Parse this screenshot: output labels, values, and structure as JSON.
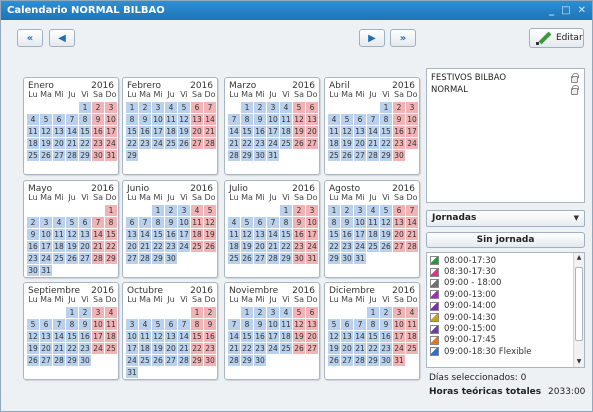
{
  "window": {
    "title": "Calendario NORMAL BILBAO",
    "minimize": "_",
    "maximize": "□",
    "close": "✕"
  },
  "toolbar": {
    "first": "«",
    "prev": "◀",
    "next": "▶",
    "last": "»",
    "edit_label": "Editar"
  },
  "dow": [
    "Lu",
    "Ma",
    "Mi",
    "Ju",
    "Vi",
    "Sa",
    "Do"
  ],
  "months": [
    {
      "name": "Enero",
      "year": "2016",
      "offset": 4,
      "days": 31
    },
    {
      "name": "Febrero",
      "year": "2016",
      "offset": 0,
      "days": 29
    },
    {
      "name": "Marzo",
      "year": "2016",
      "offset": 1,
      "days": 31
    },
    {
      "name": "Abril",
      "year": "2016",
      "offset": 4,
      "days": 30
    },
    {
      "name": "Mayo",
      "year": "2016",
      "offset": 6,
      "days": 31
    },
    {
      "name": "Junio",
      "year": "2016",
      "offset": 2,
      "days": 30
    },
    {
      "name": "Julio",
      "year": "2016",
      "offset": 4,
      "days": 31
    },
    {
      "name": "Agosto",
      "year": "2016",
      "offset": 0,
      "days": 31
    },
    {
      "name": "Septiembre",
      "year": "2016",
      "offset": 3,
      "days": 30
    },
    {
      "name": "Octubre",
      "year": "2016",
      "offset": 5,
      "days": 31
    },
    {
      "name": "Noviembre",
      "year": "2016",
      "offset": 1,
      "days": 30
    },
    {
      "name": "Diciembre",
      "year": "2016",
      "offset": 3,
      "days": 31
    }
  ],
  "festivos": {
    "items": [
      "FESTIVOS BILBAO",
      "NORMAL"
    ]
  },
  "jornadas_select": {
    "label": "Jornadas",
    "arrow": "▼"
  },
  "sin_jornada": "Sin jornada",
  "jornadas": [
    {
      "label": "08:00-17:30",
      "color": "#1f9b3a"
    },
    {
      "label": "08:30-17:30",
      "color": "#e0328f"
    },
    {
      "label": "09:00 - 18:00",
      "color": "#6f6f6f"
    },
    {
      "label": "09:00-13:00",
      "color": "#9b2fb5"
    },
    {
      "label": "09:00-14:00",
      "color": "#7c2ea8"
    },
    {
      "label": "09:00-14:30",
      "color": "#c7a21c"
    },
    {
      "label": "09:00-15:00",
      "color": "#6a3ea2"
    },
    {
      "label": "09:00-17:45",
      "color": "#e07a1f"
    },
    {
      "label": "09:00-18:30 Flexible",
      "color": "#2b6fd0"
    }
  ],
  "info": {
    "dias": "Días seleccionados: 0",
    "horas_label": "Horas teóricas totales",
    "horas_value": "2033:00"
  },
  "colors": {
    "weekday": "#b9d1ec",
    "weekend": "#f2b3b6",
    "titlebar": "#1e75b8"
  }
}
